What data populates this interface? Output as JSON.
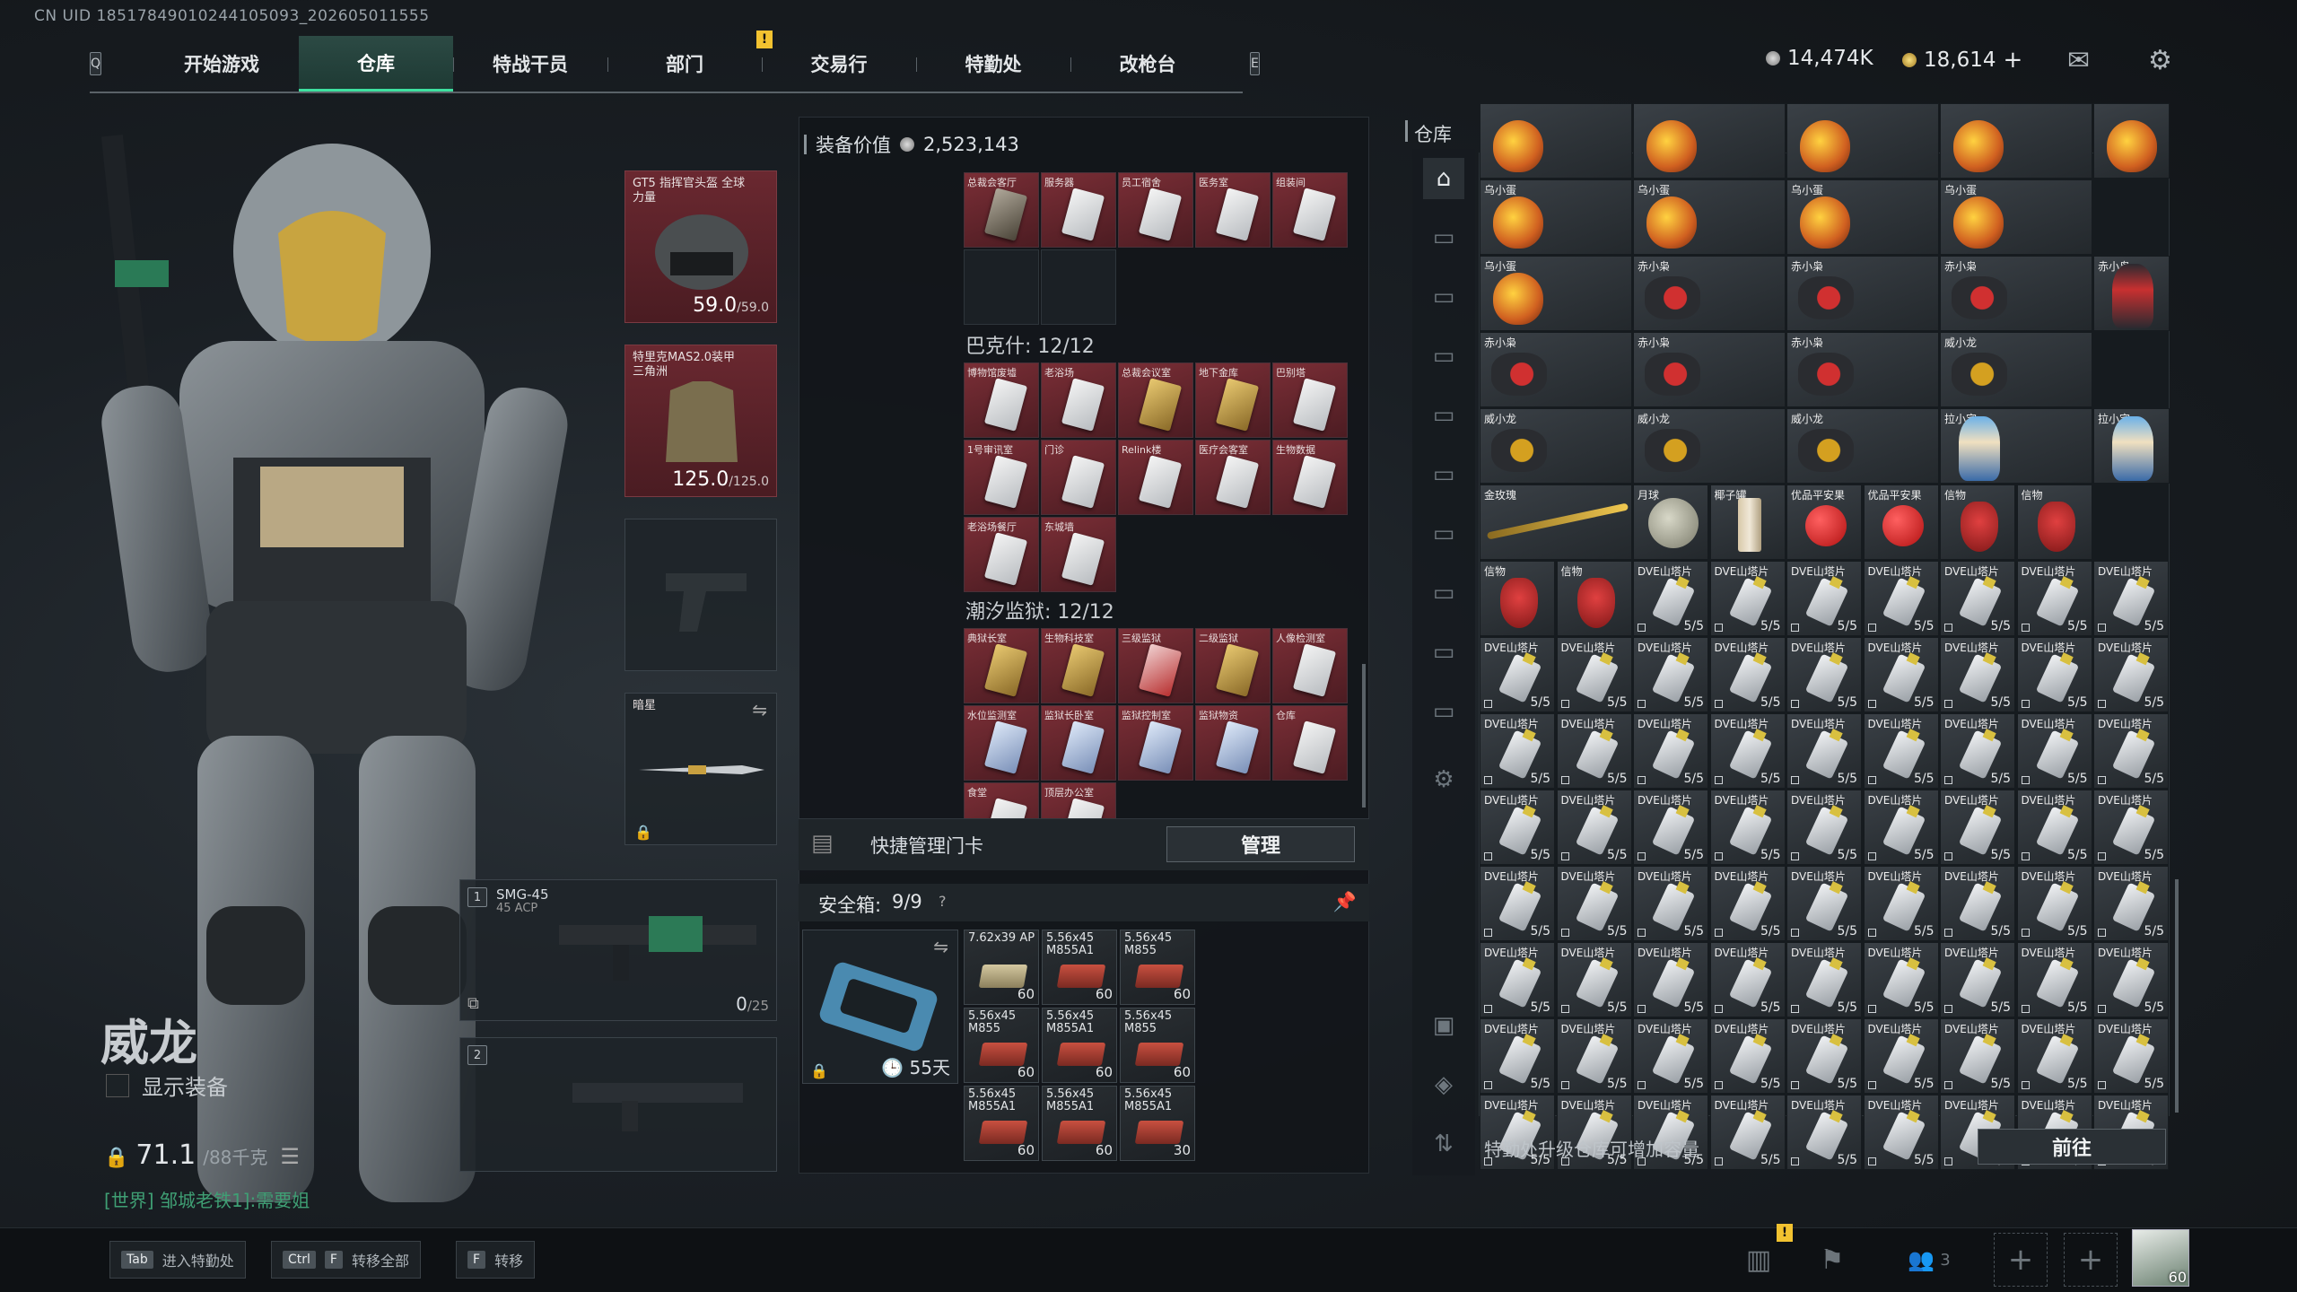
{
  "uid": "CN UID 18517849010244105093_202605011555",
  "nav": {
    "left_key": "Q",
    "right_key": "E",
    "tabs": [
      "开始游戏",
      "仓库",
      "特战干员",
      "部门",
      "交易行",
      "特勤处",
      "改枪台"
    ],
    "active_tab": 1,
    "alert": "!"
  },
  "currency": {
    "silver": "14,474K",
    "gold": "18,614",
    "gold_add": "+"
  },
  "icons": {
    "mail": "mail-icon",
    "settings": "gear-icon"
  },
  "character": {
    "name": "威龙",
    "show_equipment": "显示装备",
    "weight": "71.1",
    "weight_max": "/88千克",
    "chat": "[世界] 邹城老铁1]:需要姐"
  },
  "equipment": {
    "helmet": {
      "name": "GT5 指挥官头盔 全球力量",
      "durability": "59.0",
      "durability_max": "/59.0"
    },
    "armor": {
      "name": "特里克MAS2.0装甲 三角洲",
      "durability": "125.0",
      "durability_max": "/125.0"
    },
    "melee": {
      "name": "暗星"
    },
    "primary1": {
      "slot": "1",
      "name": "SMG-45",
      "ammo_type": "45 ACP",
      "ammo": "0",
      "ammo_max": "/25"
    },
    "primary2": {
      "slot": "2"
    }
  },
  "middle": {
    "equip_value_label": "装备价值",
    "equip_value": "2,523,143",
    "top_cards": [
      "总裁会客厅",
      "服务器",
      "员工宿舍",
      "医务室",
      "组装间"
    ],
    "section1_title": "巴克什: 12/12",
    "section1_cards": [
      "博物馆废墟",
      "老浴场",
      "总裁会议室",
      "地下金库",
      "巴别塔",
      "1号审讯室",
      "门诊",
      "Relink楼",
      "医疗会客室",
      "生物数据",
      "老浴场餐厅",
      "东城墙"
    ],
    "section2_title": "潮汐监狱: 12/12",
    "section2_cards": [
      "典狱长室",
      "生物科技室",
      "三级监狱",
      "二级监狱",
      "人像检测室",
      "水位监测室",
      "监狱长卧室",
      "监狱控制室",
      "监狱物资",
      "仓库",
      "食堂",
      "顶层办公室"
    ],
    "quick_label": "快捷管理门卡",
    "manage_btn": "管理",
    "safe_label": "安全箱:",
    "safe_count": "9/9",
    "safe_help": "?",
    "safe_days": "55天",
    "ammo": [
      {
        "lbl": "7.62x39 AP",
        "cnt": "60"
      },
      {
        "lbl": "5.56x45 M855A1",
        "cnt": "60"
      },
      {
        "lbl": "5.56x45 M855",
        "cnt": "60"
      },
      {
        "lbl": "5.56x45 M855",
        "cnt": "60"
      },
      {
        "lbl": "5.56x45 M855A1",
        "cnt": "60"
      },
      {
        "lbl": "5.56x45 M855",
        "cnt": "60"
      },
      {
        "lbl": "5.56x45 M855A1",
        "cnt": "60"
      },
      {
        "lbl": "5.56x45 M855A1",
        "cnt": "60"
      },
      {
        "lbl": "5.56x45 M855A1",
        "cnt": "30"
      }
    ]
  },
  "warehouse": {
    "title": "仓库",
    "footer_text": "特勤处升级仓库可增加容量",
    "go_btn": "前往",
    "rows": [
      [
        {
          "lbl": "乌小蛋",
          "t": "egg"
        },
        {
          "lbl": "乌小蛋",
          "t": "egg"
        },
        {
          "lbl": "乌小蛋",
          "t": "egg"
        },
        {
          "lbl": "乌小蛋",
          "t": "egg"
        }
      ],
      [
        {
          "lbl": "乌小蛋",
          "t": "egg"
        },
        {
          "lbl": "赤小枭",
          "t": "mech"
        },
        {
          "lbl": "赤小枭",
          "t": "mech"
        },
        {
          "lbl": "赤小枭",
          "t": "mech"
        }
      ],
      [
        {
          "lbl": "赤小枭",
          "t": "mech"
        },
        {
          "lbl": "赤小枭",
          "t": "mech"
        },
        {
          "lbl": "赤小枭",
          "t": "mech"
        },
        {
          "lbl": "威小龙",
          "t": "mechg"
        }
      ],
      [
        {
          "lbl": "威小龙",
          "t": "mechg"
        },
        {
          "lbl": "威小龙",
          "t": "mechg"
        },
        {
          "lbl": "威小龙",
          "t": "mechg"
        },
        {
          "lbl": "拉小宅",
          "t": "fig"
        }
      ],
      [
        {
          "lbl": "金玫瑰",
          "t": "rose"
        },
        {
          "lbl": "",
          "t": "skip"
        },
        {
          "lbl": "月球",
          "t": "moon"
        },
        {
          "lbl": "椰子罐",
          "t": "can"
        },
        {
          "lbl": "优品平安果",
          "t": "apple"
        },
        {
          "lbl": "优品平安果",
          "t": "apple"
        },
        {
          "lbl": "信物",
          "t": "mask"
        },
        {
          "lbl": "信物",
          "t": "mask"
        }
      ],
      [
        {
          "lbl": "信物",
          "t": "mask"
        },
        {
          "lbl": "信物",
          "t": "mask"
        }
      ]
    ],
    "right_col": [
      {
        "lbl": "",
        "t": "egg"
      },
      {
        "lbl": "赤小枭",
        "t": "figr"
      },
      {
        "lbl": "拉小宅",
        "t": "fig"
      }
    ],
    "dve_label": "DVE山塔片",
    "dve_count": "5/5"
  },
  "bottom": {
    "hotkeys": [
      {
        "key": "Tab",
        "label": "进入特勤处"
      },
      {
        "key": "Ctrl",
        "key2": "F",
        "label": "转移全部"
      },
      {
        "key": "F",
        "label": "转移"
      }
    ],
    "friends": "3",
    "level": "60"
  }
}
